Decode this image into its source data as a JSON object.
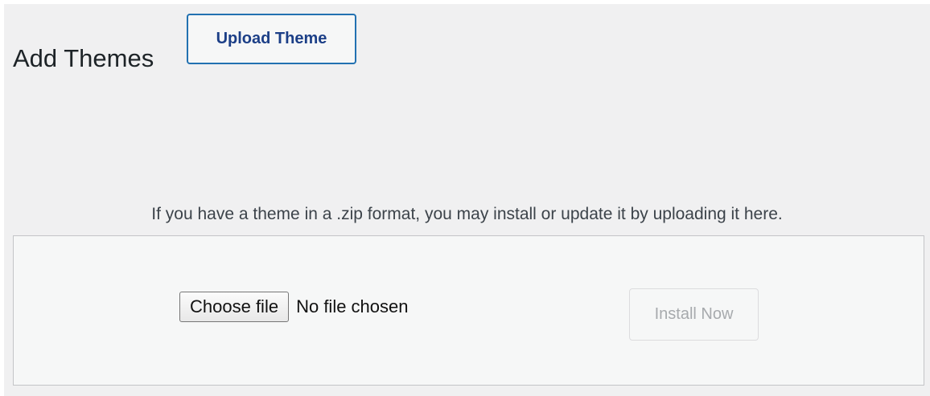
{
  "header": {
    "title": "Add Themes",
    "upload_button_label": "Upload Theme"
  },
  "upload_form": {
    "help_text": "If you have a theme in a .zip format, you may install or update it by uploading it here.",
    "choose_file_label": "Choose file",
    "file_status": "No file chosen",
    "install_button_label": "Install Now",
    "install_button_disabled": true
  },
  "colors": {
    "page_background": "#f0f0f1",
    "accent": "#2271b1",
    "upload_button_text": "#1c3f87",
    "disabled_text": "#a7aaad",
    "box_border": "#c3c4c7"
  }
}
